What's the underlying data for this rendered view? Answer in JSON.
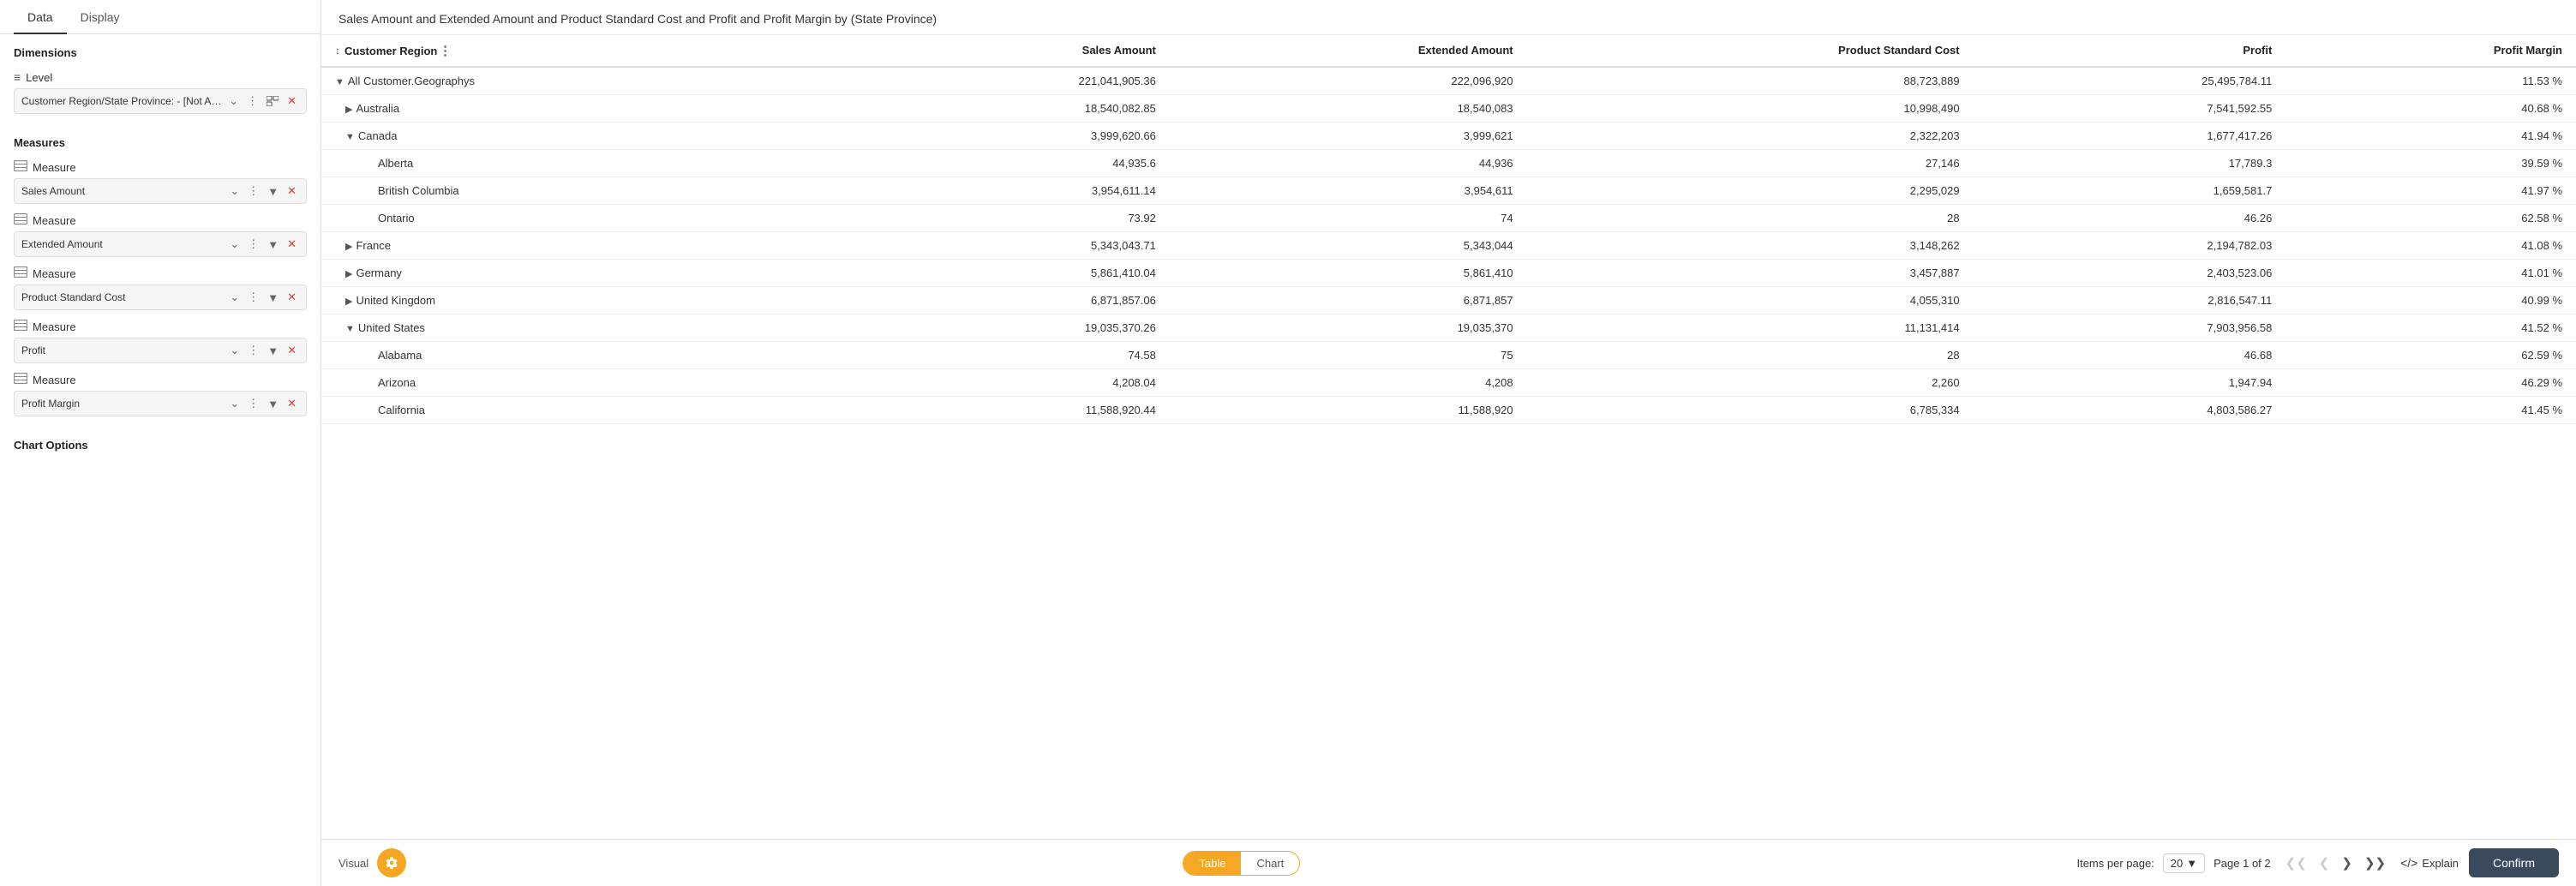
{
  "sidebar": {
    "tabs": [
      {
        "id": "data",
        "label": "Data"
      },
      {
        "id": "display",
        "label": "Display"
      }
    ],
    "active_tab": "Data",
    "sections": {
      "dimensions": {
        "title": "Dimensions",
        "level": "Level",
        "field": {
          "label": "Customer Region/State Province: - [Not Appli...",
          "controls": [
            "chevron-down",
            "three-dots",
            "expand-icon",
            "remove"
          ]
        }
      },
      "measures": {
        "title": "Measures",
        "items": [
          {
            "group_label": "Measure",
            "field_label": "Sales Amount"
          },
          {
            "group_label": "Measure",
            "field_label": "Extended Amount"
          },
          {
            "group_label": "Measure",
            "field_label": "Product Standard Cost"
          },
          {
            "group_label": "Measure",
            "field_label": "Profit"
          },
          {
            "group_label": "Measure",
            "field_label": "Profit Margin"
          }
        ]
      }
    },
    "chart_options_title": "Chart Options"
  },
  "chart": {
    "title": "Sales Amount and Extended Amount and Product Standard Cost and Profit and Profit Margin by (State Province)",
    "columns": [
      {
        "id": "region",
        "label": "Customer Region"
      },
      {
        "id": "sales",
        "label": "Sales Amount"
      },
      {
        "id": "extended",
        "label": "Extended Amount"
      },
      {
        "id": "product_cost",
        "label": "Product Standard Cost"
      },
      {
        "id": "profit",
        "label": "Profit"
      },
      {
        "id": "margin",
        "label": "Profit Margin"
      }
    ],
    "rows": [
      {
        "level": 0,
        "expand": "collapse",
        "name": "All Customer.Geographys",
        "sales": "221,041,905.36",
        "extended": "222,096,920",
        "product_cost": "88,723,889",
        "profit": "25,495,784.11",
        "margin": "11.53 %"
      },
      {
        "level": 1,
        "expand": "expand",
        "name": "Australia",
        "sales": "18,540,082.85",
        "extended": "18,540,083",
        "product_cost": "10,998,490",
        "profit": "7,541,592.55",
        "margin": "40.68 %"
      },
      {
        "level": 1,
        "expand": "collapse",
        "name": "Canada",
        "sales": "3,999,620.66",
        "extended": "3,999,621",
        "product_cost": "2,322,203",
        "profit": "1,677,417.26",
        "margin": "41.94 %"
      },
      {
        "level": 2,
        "expand": "none",
        "name": "Alberta",
        "sales": "44,935.6",
        "extended": "44,936",
        "product_cost": "27,146",
        "profit": "17,789.3",
        "margin": "39.59 %"
      },
      {
        "level": 2,
        "expand": "none",
        "name": "British Columbia",
        "sales": "3,954,611.14",
        "extended": "3,954,611",
        "product_cost": "2,295,029",
        "profit": "1,659,581.7",
        "margin": "41.97 %"
      },
      {
        "level": 2,
        "expand": "none",
        "name": "Ontario",
        "sales": "73.92",
        "extended": "74",
        "product_cost": "28",
        "profit": "46.26",
        "margin": "62.58 %"
      },
      {
        "level": 1,
        "expand": "expand",
        "name": "France",
        "sales": "5,343,043.71",
        "extended": "5,343,044",
        "product_cost": "3,148,262",
        "profit": "2,194,782.03",
        "margin": "41.08 %"
      },
      {
        "level": 1,
        "expand": "expand",
        "name": "Germany",
        "sales": "5,861,410.04",
        "extended": "5,861,410",
        "product_cost": "3,457,887",
        "profit": "2,403,523.06",
        "margin": "41.01 %"
      },
      {
        "level": 1,
        "expand": "expand",
        "name": "United Kingdom",
        "sales": "6,871,857.06",
        "extended": "6,871,857",
        "product_cost": "4,055,310",
        "profit": "2,816,547.11",
        "margin": "40.99 %"
      },
      {
        "level": 1,
        "expand": "collapse",
        "name": "United States",
        "sales": "19,035,370.26",
        "extended": "19,035,370",
        "product_cost": "11,131,414",
        "profit": "7,903,956.58",
        "margin": "41.52 %"
      },
      {
        "level": 2,
        "expand": "none",
        "name": "Alabama",
        "sales": "74.58",
        "extended": "75",
        "product_cost": "28",
        "profit": "46.68",
        "margin": "62.59 %"
      },
      {
        "level": 2,
        "expand": "none",
        "name": "Arizona",
        "sales": "4,208.04",
        "extended": "4,208",
        "product_cost": "2,260",
        "profit": "1,947.94",
        "margin": "46.29 %"
      },
      {
        "level": 2,
        "expand": "none",
        "name": "California",
        "sales": "11,588,920.44",
        "extended": "11,588,920",
        "product_cost": "6,785,334",
        "profit": "4,803,586.27",
        "margin": "41.45 %"
      }
    ],
    "pagination": {
      "items_per_page_label": "Items per page:",
      "items_per_page_value": "20",
      "page_label": "Page 1 of 2"
    },
    "footer": {
      "visual_label": "Visual",
      "table_label": "Table",
      "chart_label": "Chart",
      "explain_label": "Explain",
      "confirm_label": "Confirm"
    }
  }
}
